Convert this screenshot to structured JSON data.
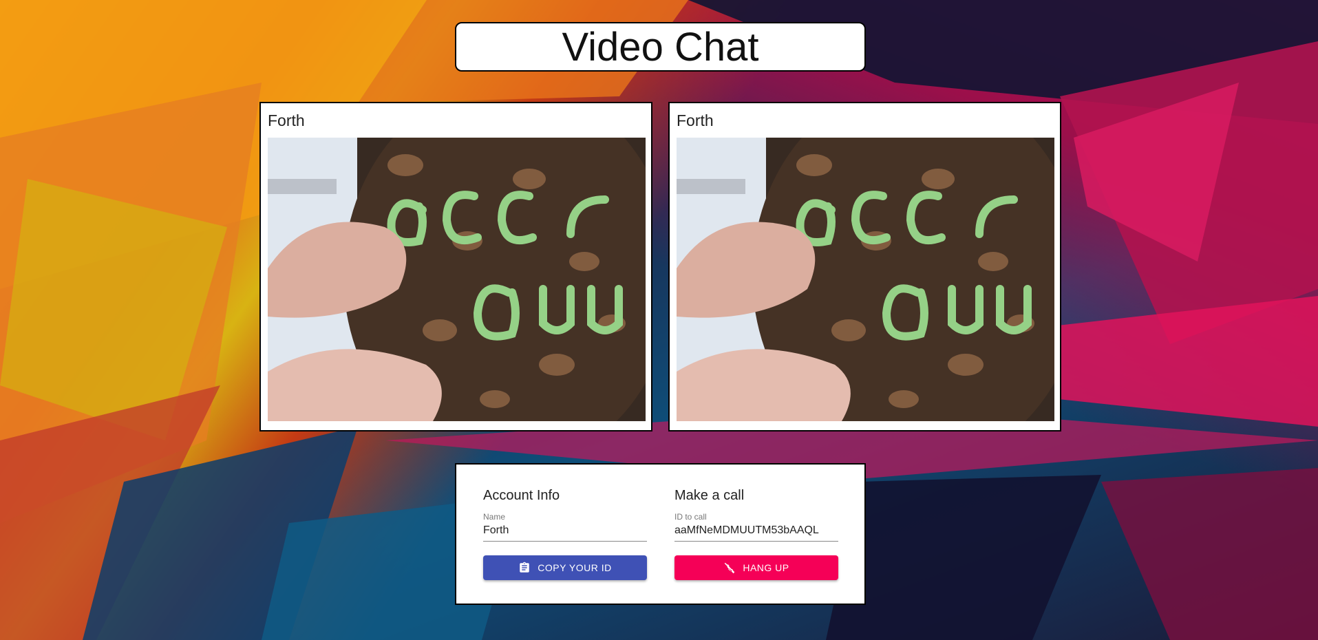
{
  "app": {
    "title": "Video Chat"
  },
  "videos": [
    {
      "name": "Forth"
    },
    {
      "name": "Forth"
    }
  ],
  "account": {
    "heading": "Account Info",
    "name_label": "Name",
    "name_value": "Forth",
    "copy_button": "COPY YOUR ID"
  },
  "call": {
    "heading": "Make a call",
    "id_label": "ID to call",
    "id_value": "aaMfNeMDMUUTM53bAAQL",
    "hangup_button": "HANG UP"
  },
  "colors": {
    "primary": "#3f51b5",
    "secondary": "#f50057"
  },
  "icons": {
    "copy": "clipboard-icon",
    "hangup": "phone-disabled-icon"
  }
}
